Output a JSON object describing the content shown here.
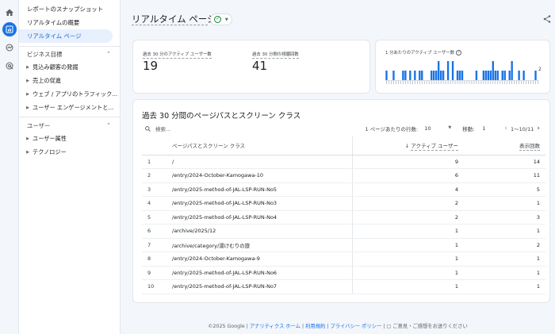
{
  "sidebar": {
    "links": [
      {
        "label": "レポートのスナップショット",
        "active": false
      },
      {
        "label": "リアルタイムの概要",
        "active": false
      },
      {
        "label": "リアルタイム ページ",
        "active": true
      }
    ],
    "sections": [
      {
        "heading": "ビジネス目標",
        "items": [
          "見込み顧客の発掘",
          "売上の促進",
          "ウェブ / アプリのトラフィック...",
          "ユーザー エンゲージメントと..."
        ]
      },
      {
        "heading": "ユーザー",
        "items": [
          "ユーザー属性",
          "テクノロジー"
        ]
      }
    ]
  },
  "header": {
    "title": "リアルタイム ページ"
  },
  "metrics": [
    {
      "label": "過去 30 分のアクティブ ユーザー数",
      "value": "19"
    },
    {
      "label": "過去 30 分間の視聴回数",
      "value": "41"
    }
  ],
  "sparkline": {
    "label": "1 分あたりのアクティブ ユーザー数",
    "max_label": "2",
    "values": [
      1,
      0,
      0,
      1,
      0,
      0,
      0,
      1,
      1,
      0,
      1,
      0,
      1,
      0,
      1,
      1,
      0,
      0,
      0,
      1,
      1,
      1,
      2,
      1,
      1,
      0,
      2,
      0,
      2,
      0,
      1,
      1,
      1,
      0,
      0,
      0,
      0,
      0,
      1,
      0,
      0,
      1,
      1,
      1,
      1,
      2,
      1,
      1,
      0,
      1,
      1,
      0,
      1,
      2,
      0,
      0,
      1,
      0,
      1,
      0,
      0,
      0,
      0,
      1,
      0
    ],
    "color": "#1a73e8"
  },
  "table": {
    "title": "過去 30 分間のページパスとスクリーン クラス",
    "search_placeholder": "検索...",
    "rows_per_page_label": "1 ページあたりの行数:",
    "rows_per_page": "10",
    "jump_label": "移動:",
    "jump_value": "1",
    "range": "1〜10/11",
    "columns": {
      "path": "ページパスとスクリーン クラス",
      "users": "アクティブ ユーザー",
      "views": "表示回数"
    },
    "rows": [
      {
        "n": "1",
        "path": "/",
        "users": "9",
        "views": "14"
      },
      {
        "n": "2",
        "path": "/entry/2024-October-Kamogawa-10",
        "users": "6",
        "views": "11"
      },
      {
        "n": "3",
        "path": "/entry/2025-method-of-JAL-LSP-RUN-No5",
        "users": "4",
        "views": "5"
      },
      {
        "n": "4",
        "path": "/entry/2025-method-of-JAL-LSP-RUN-No3",
        "users": "2",
        "views": "1"
      },
      {
        "n": "5",
        "path": "/entry/2025-method-of-JAL-LSP-RUN-No4",
        "users": "2",
        "views": "3"
      },
      {
        "n": "6",
        "path": "/archive/2025/12",
        "users": "1",
        "views": "1"
      },
      {
        "n": "7",
        "path": "/archive/category/湯けむりの旅",
        "users": "1",
        "views": "2"
      },
      {
        "n": "8",
        "path": "/entry/2024-October-Kamogawa-9",
        "users": "1",
        "views": "1"
      },
      {
        "n": "9",
        "path": "/entry/2025-method-of-JAL-LSP-RUN-No6",
        "users": "1",
        "views": "1"
      },
      {
        "n": "10",
        "path": "/entry/2025-method-of-JAL-LSP-RUN-No7",
        "users": "1",
        "views": "1"
      }
    ]
  },
  "footer": {
    "copyright": "©2025 Google | ",
    "link1": "アナリティクス ホーム",
    "sep1": " | ",
    "link2": "利用規約",
    "sep2": " | ",
    "link3": "プライバシー ポリシー",
    "sep3": " | ",
    "feedback": "ご意見・ご感想をお送りください"
  }
}
